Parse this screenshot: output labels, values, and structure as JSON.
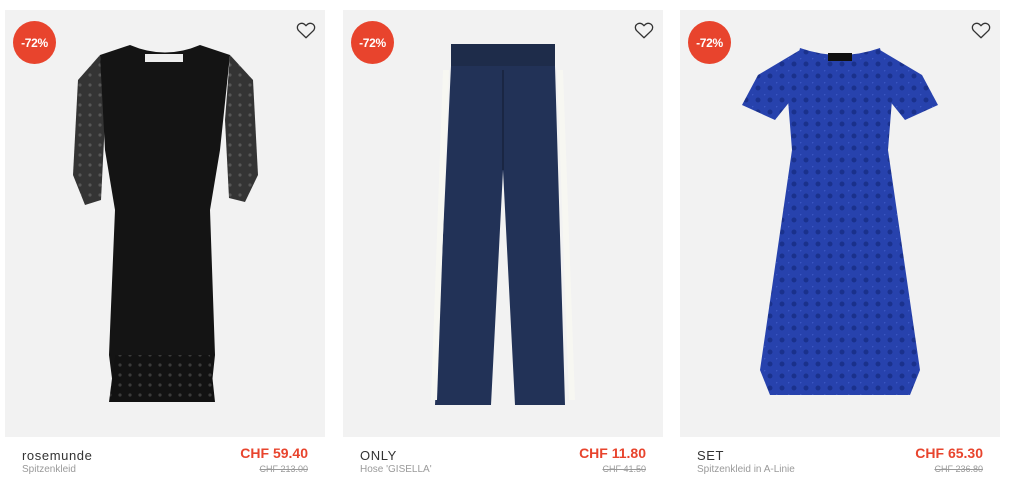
{
  "products": [
    {
      "badge": "-72%",
      "brand": "rosemunde",
      "name": "Spitzenkleid",
      "price": "CHF 59.40",
      "old_price": "CHF 213.00",
      "image_icon": "black-lace-dress",
      "color": "#111111"
    },
    {
      "badge": "-72%",
      "brand": "ONLY",
      "name": "Hose 'GISELLA'",
      "price": "CHF 11.80",
      "old_price": "CHF 41.50",
      "image_icon": "navy-wide-trousers",
      "color": "#1f2d4d"
    },
    {
      "badge": "-72%",
      "brand": "SET",
      "name": "Spitzenkleid in A-Linie",
      "price": "CHF 65.30",
      "old_price": "CHF 236.80",
      "image_icon": "blue-lace-dress",
      "color": "#2440a8"
    }
  ],
  "colors": {
    "badge": "#e8442d",
    "price": "#e8442d",
    "image_bg": "#f2f2f2"
  },
  "icons": {
    "wishlist": "heart-outline-icon"
  }
}
